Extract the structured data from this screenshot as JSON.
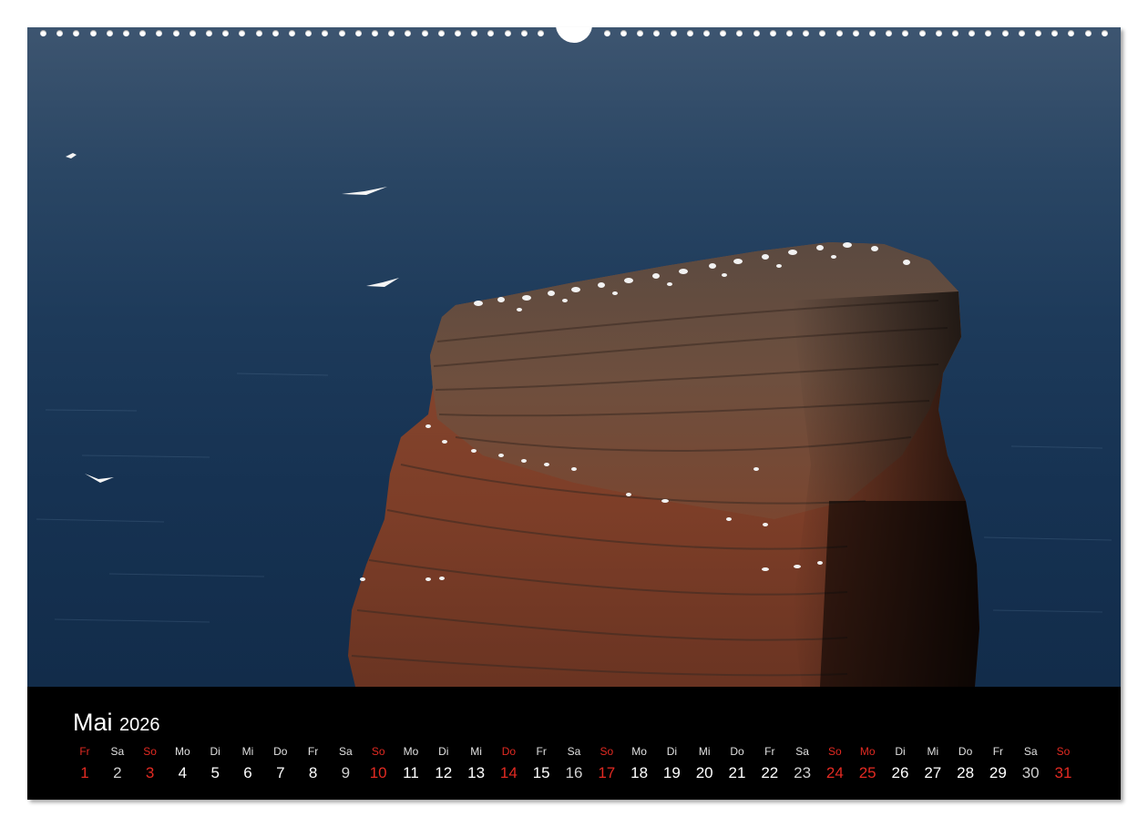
{
  "calendar": {
    "month": "Mai",
    "year": "2026",
    "days": [
      {
        "wd": "Fr",
        "d": "1",
        "holiday": true
      },
      {
        "wd": "Sa",
        "d": "2",
        "holiday": false
      },
      {
        "wd": "So",
        "d": "3",
        "holiday": true
      },
      {
        "wd": "Mo",
        "d": "4",
        "holiday": false
      },
      {
        "wd": "Di",
        "d": "5",
        "holiday": false
      },
      {
        "wd": "Mi",
        "d": "6",
        "holiday": false
      },
      {
        "wd": "Do",
        "d": "7",
        "holiday": false
      },
      {
        "wd": "Fr",
        "d": "8",
        "holiday": false
      },
      {
        "wd": "Sa",
        "d": "9",
        "holiday": false
      },
      {
        "wd": "So",
        "d": "10",
        "holiday": true
      },
      {
        "wd": "Mo",
        "d": "11",
        "holiday": false
      },
      {
        "wd": "Di",
        "d": "12",
        "holiday": false
      },
      {
        "wd": "Mi",
        "d": "13",
        "holiday": false
      },
      {
        "wd": "Do",
        "d": "14",
        "holiday": true
      },
      {
        "wd": "Fr",
        "d": "15",
        "holiday": false
      },
      {
        "wd": "Sa",
        "d": "16",
        "holiday": false
      },
      {
        "wd": "So",
        "d": "17",
        "holiday": true
      },
      {
        "wd": "Mo",
        "d": "18",
        "holiday": false
      },
      {
        "wd": "Di",
        "d": "19",
        "holiday": false
      },
      {
        "wd": "Mi",
        "d": "20",
        "holiday": false
      },
      {
        "wd": "Do",
        "d": "21",
        "holiday": false
      },
      {
        "wd": "Fr",
        "d": "22",
        "holiday": false
      },
      {
        "wd": "Sa",
        "d": "23",
        "holiday": false
      },
      {
        "wd": "So",
        "d": "24",
        "holiday": true
      },
      {
        "wd": "Mo",
        "d": "25",
        "holiday": true
      },
      {
        "wd": "Di",
        "d": "26",
        "holiday": false
      },
      {
        "wd": "Mi",
        "d": "27",
        "holiday": false
      },
      {
        "wd": "Do",
        "d": "28",
        "holiday": false
      },
      {
        "wd": "Fr",
        "d": "29",
        "holiday": false
      },
      {
        "wd": "Sa",
        "d": "30",
        "holiday": false
      },
      {
        "wd": "So",
        "d": "31",
        "holiday": true
      }
    ]
  },
  "colors": {
    "holiday": "#e22a22",
    "background": "#000000",
    "text": "#ffffff"
  },
  "photo": {
    "subject": "sea-stack-with-gannets"
  }
}
